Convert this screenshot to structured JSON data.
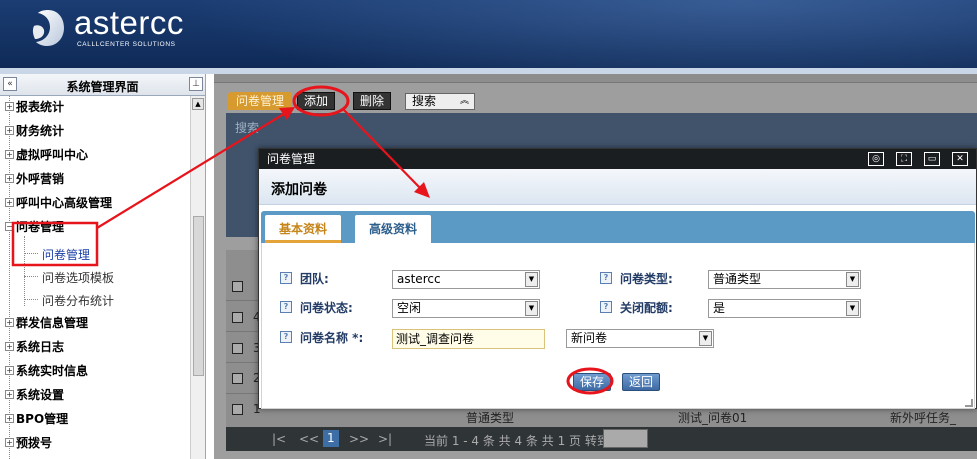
{
  "brand": {
    "name": "astercc",
    "tagline": "CALLLCENTER SOLUTIONS"
  },
  "sidebar": {
    "title": "系统管理界面",
    "collapse_glyph": "«",
    "pin_glyph": "⊥",
    "items": [
      {
        "label": "报表统计"
      },
      {
        "label": "财务统计"
      },
      {
        "label": "虚拟呼叫中心"
      },
      {
        "label": "外呼营销"
      },
      {
        "label": "呼叫中心高级管理"
      },
      {
        "label": "问卷管理"
      },
      {
        "label": "群发信息管理"
      },
      {
        "label": "系统日志"
      },
      {
        "label": "系统实时信息"
      },
      {
        "label": "系统设置"
      },
      {
        "label": "BPO管理"
      },
      {
        "label": "预拨号"
      }
    ],
    "subitems": [
      {
        "label": "问卷管理"
      },
      {
        "label": "问卷选项模板"
      },
      {
        "label": "问卷分布统计"
      }
    ]
  },
  "toolbar": {
    "tab": "问卷管理",
    "add": "添加",
    "delete": "删除",
    "search": "搜索",
    "search_panel_label": "搜索"
  },
  "list": {
    "rows": [
      "4",
      "3",
      "2",
      "1"
    ],
    "last_row_text": [
      "普通类型",
      "测试_问卷01",
      "新外呼任务_"
    ]
  },
  "pager": {
    "first": "|<",
    "prev": "<<",
    "current": "1",
    "next": ">>",
    "last": ">|",
    "summary": "当前 1 - 4 条 共 4 条 共 1 页 转到"
  },
  "modal": {
    "window_title": "问卷管理",
    "heading": "添加问卷",
    "tabs": [
      "基本资料",
      "高级资料"
    ],
    "fields": {
      "team": {
        "label": "团队:",
        "value": "astercc"
      },
      "type": {
        "label": "问卷类型:",
        "value": "普通类型"
      },
      "status": {
        "label": "问卷状态:",
        "value": "空闲"
      },
      "close_quota": {
        "label": "关闭配额:",
        "value": "是"
      },
      "name": {
        "label": "问卷名称 *:",
        "value": "测试_调查问卷"
      },
      "name_select": {
        "value": "新问卷"
      }
    },
    "save": "保存",
    "back": "返回"
  },
  "colors": {
    "annotation_red": "#e8141c",
    "header_bg": "#13305f",
    "tab_gold": "#d69a2e"
  }
}
